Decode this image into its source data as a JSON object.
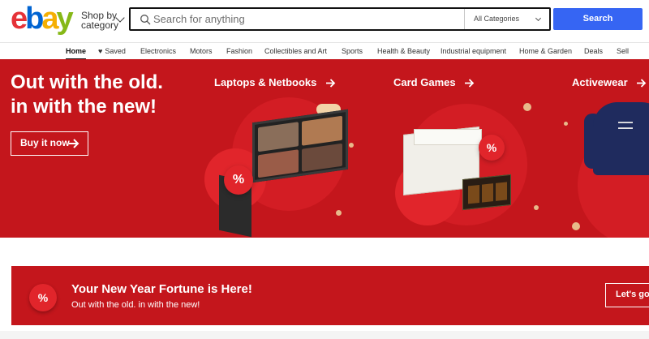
{
  "header": {
    "logo_letters": [
      "e",
      "b",
      "a",
      "y"
    ],
    "logo_colors": [
      "#e53238",
      "#0064d2",
      "#f5af02",
      "#86b817"
    ],
    "shop_by_line1": "Shop by",
    "shop_by_line2": "category",
    "search_placeholder": "Search for anything",
    "category_select": "All Categories",
    "search_button": "Search",
    "search_button_color": "#3665f3"
  },
  "nav": {
    "items": [
      {
        "label": "Home",
        "active": true
      },
      {
        "label": "Saved",
        "icon": "heart-icon"
      },
      {
        "label": "Electronics"
      },
      {
        "label": "Motors"
      },
      {
        "label": "Fashion"
      },
      {
        "label": "Collectibles and Art"
      },
      {
        "label": "Sports"
      },
      {
        "label": "Health & Beauty"
      },
      {
        "label": "Industrial equipment"
      },
      {
        "label": "Home & Garden"
      },
      {
        "label": "Deals"
      },
      {
        "label": "Sell"
      }
    ]
  },
  "hero": {
    "title_line1": "Out with the old.",
    "title_line2": "in with the new!",
    "cta": "Buy it now",
    "background": "#c4161c",
    "categories": [
      {
        "label": "Laptops & Netbooks"
      },
      {
        "label": "Card Games"
      },
      {
        "label": "Activewear"
      }
    ],
    "badge_text": "%"
  },
  "promo": {
    "badge_text": "%",
    "title": "Your New Year Fortune is Here!",
    "subtitle": "Out with the old. in with the new!",
    "cta": "Let's go"
  }
}
